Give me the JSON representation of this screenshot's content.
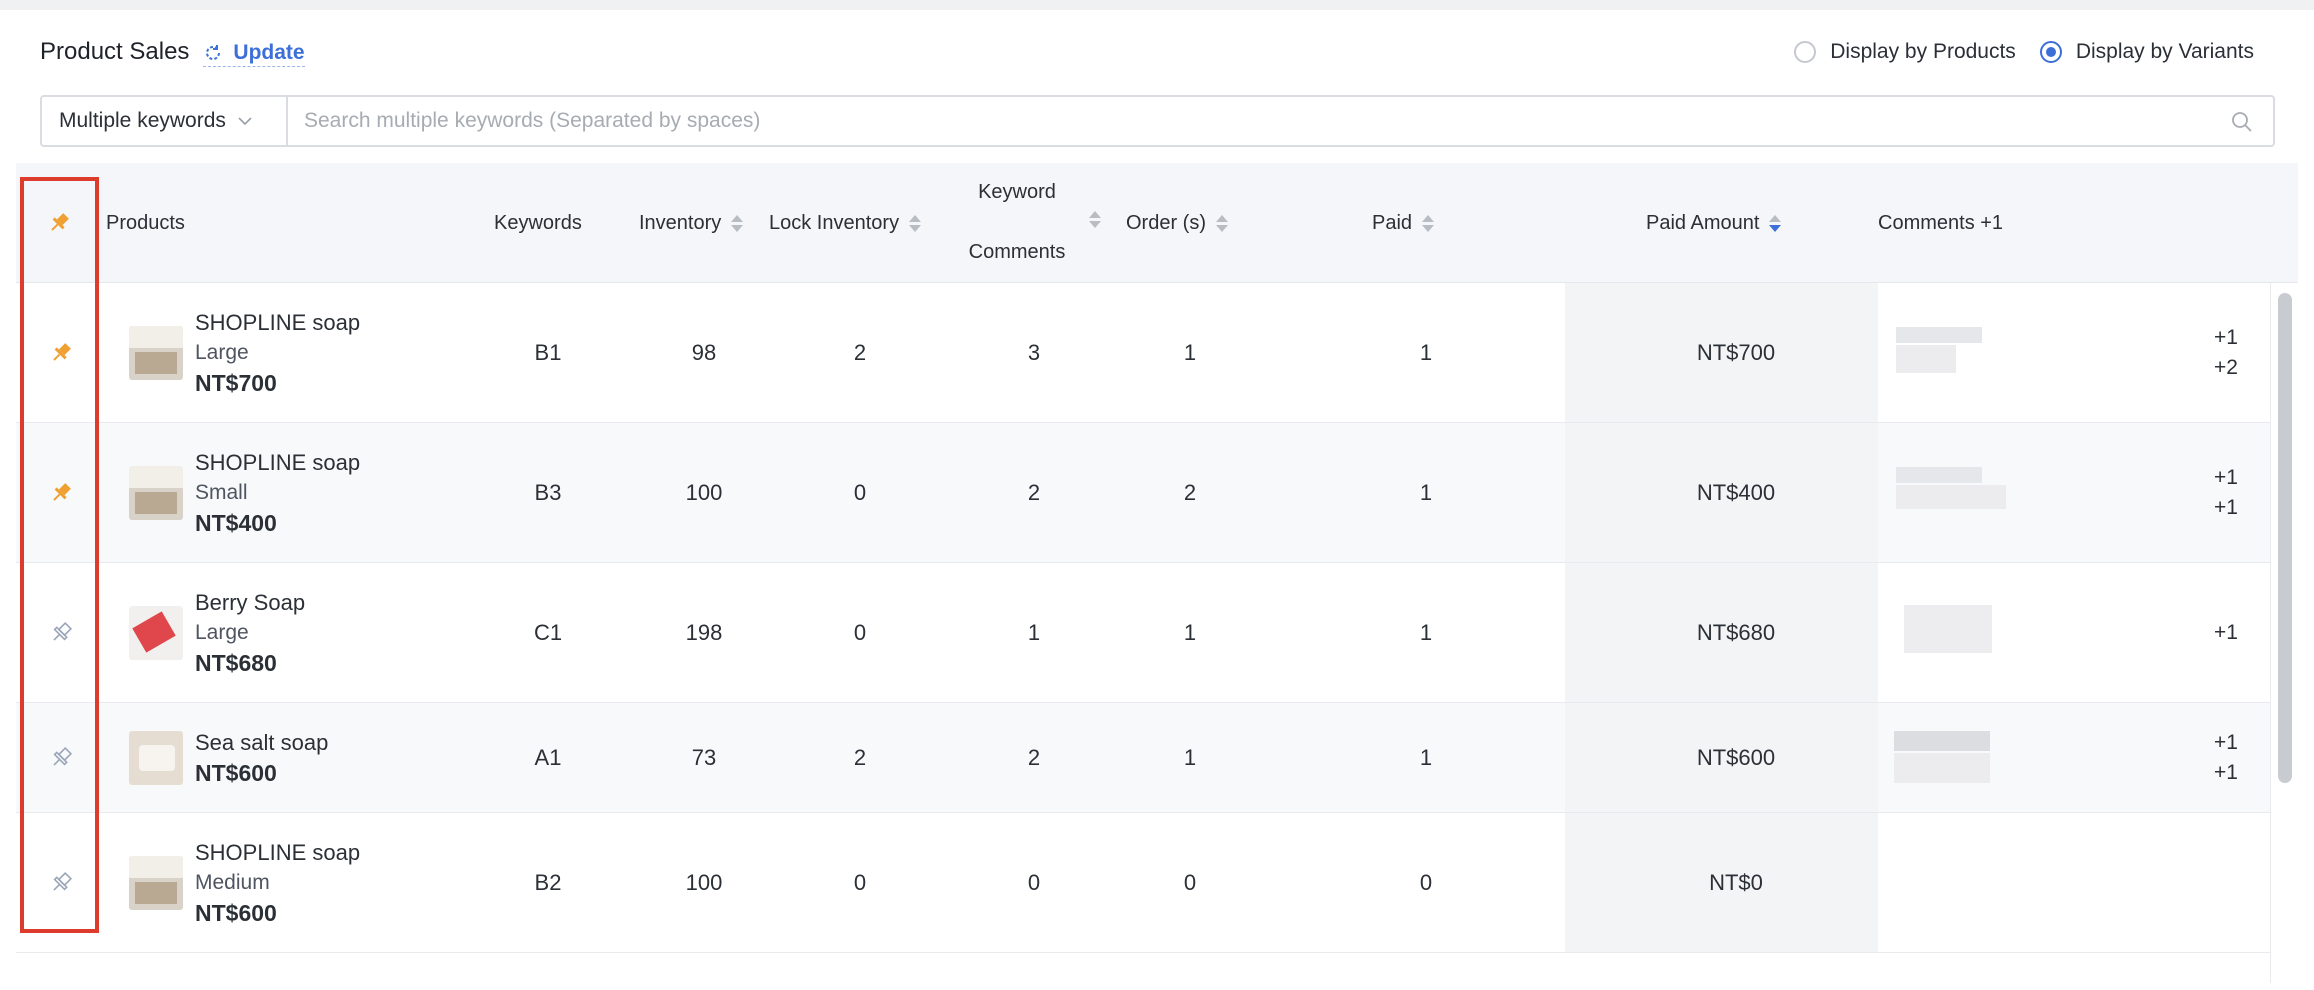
{
  "header": {
    "title": "Product Sales",
    "update_label": "Update",
    "radio_products": "Display by Products",
    "radio_variants": "Display by Variants",
    "selected": "Display by Variants"
  },
  "search": {
    "mode": "Multiple keywords",
    "placeholder": "Search multiple keywords (Separated by spaces)"
  },
  "columns": {
    "products": "Products",
    "keywords": "Keywords",
    "inventory": "Inventory",
    "lock_inventory": "Lock Inventory",
    "keyword_comments_line1": "Keyword",
    "keyword_comments_line2": "Comments",
    "orders": "Order (s)",
    "paid": "Paid",
    "paid_amount": "Paid Amount",
    "comments": "Comments +1"
  },
  "rows": [
    {
      "pinned": true,
      "name": "SHOPLINE soap",
      "variant": "Large",
      "price": "NT$700",
      "keyword": "B1",
      "inventory": "98",
      "lock": "2",
      "kw_comments": "3",
      "orders": "1",
      "paid": "1",
      "paid_amount": "NT$700",
      "plus1": "+1",
      "plus2": "+2"
    },
    {
      "pinned": true,
      "name": "SHOPLINE soap",
      "variant": "Small",
      "price": "NT$400",
      "keyword": "B3",
      "inventory": "100",
      "lock": "0",
      "kw_comments": "2",
      "orders": "2",
      "paid": "1",
      "paid_amount": "NT$400",
      "plus1": "+1",
      "plus2": "+1"
    },
    {
      "pinned": false,
      "name": "Berry Soap",
      "variant": "Large",
      "price": "NT$680",
      "keyword": "C1",
      "inventory": "198",
      "lock": "0",
      "kw_comments": "1",
      "orders": "1",
      "paid": "1",
      "paid_amount": "NT$680",
      "plus1": "+1",
      "plus2": ""
    },
    {
      "pinned": false,
      "name": "Sea salt soap",
      "variant": "",
      "price": "NT$600",
      "keyword": "A1",
      "inventory": "73",
      "lock": "2",
      "kw_comments": "2",
      "orders": "1",
      "paid": "1",
      "paid_amount": "NT$600",
      "plus1": "+1",
      "plus2": "+1"
    },
    {
      "pinned": false,
      "name": "SHOPLINE soap",
      "variant": "Medium",
      "price": "NT$600",
      "keyword": "B2",
      "inventory": "100",
      "lock": "0",
      "kw_comments": "0",
      "orders": "0",
      "paid": "0",
      "paid_amount": "NT$0",
      "plus1": "",
      "plus2": ""
    }
  ],
  "colors": {
    "accent": "#3d6fd9",
    "pin_active": "#f0a030",
    "highlight": "#dd3b2c"
  },
  "icons": {
    "pin": "pin-icon",
    "refresh": "refresh-icon",
    "search": "search-icon",
    "chevron": "chevron-down-icon"
  }
}
